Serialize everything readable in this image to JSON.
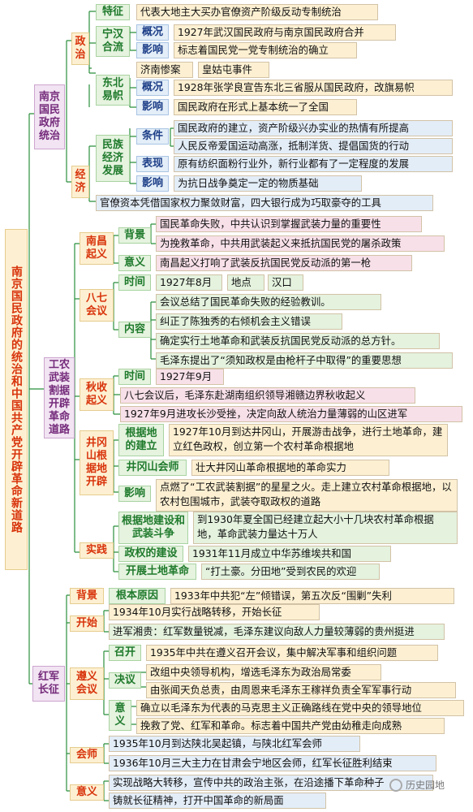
{
  "root": "南京国民政府的统治和中国共产党开辟革命新道路",
  "sections": {
    "nanjing": {
      "title": "南京国民政府统治",
      "politics": "政治",
      "economy": "经济",
      "tezheng_label": "特征",
      "tezheng": "代表大地主大买办官僚资产阶级反动专制统治",
      "ninghan_label": "宁汉合流",
      "ninghan_gaikuang_label": "概况",
      "ninghan_gaikuang": "1927年武汉国民政府与南京国民政府合并",
      "ninghan_yingxiang_label": "影响",
      "ninghan_yingxiang": "标志着国民党一党专制统治的确立",
      "jinan": "济南惨案",
      "jinan_desc": "皇姑屯事件",
      "dongbei_label": "东北易帜",
      "dongbei_gaikuang_label": "概况",
      "dongbei_gaikuang": "1928年张学良宣告东北三省服从国民政府，改旗易帜",
      "dongbei_yingxiang_label": "影响",
      "dongbei_yingxiang": "国民政府在形式上基本统一了全国",
      "minzu_label": "民族经济发展",
      "tiaojian_label": "条件",
      "tiaojian_1": "国民政府的建立，资产阶级兴办实业的热情有所提高",
      "tiaojian_2": "人民反帝爱国运动高涨，抵制洋货、提倡国货的行动",
      "biaoxian_label": "表现",
      "biaoxian": "原有纺织面粉行业外，新行业都有了一定程度的发展",
      "minzu_yingxiang_label": "影响",
      "minzu_yingxiang": "为抗日战争奠定一定的物质基础",
      "guanliao": "官僚资本凭借国家权力聚敛财富，四大银行成为巧取豪夺的工具"
    },
    "gongnong": {
      "title": "工农武装割据开辟革命道路",
      "nanchang_label": "南昌起义",
      "beijing_label": "背景",
      "beijing_1": "国民革命失败，中共认识到掌握武装力量的重要性",
      "beijing_2": "为挽救革命，中共用武装起义来抵抗国民党的屠杀政策",
      "yiyi_label": "意义",
      "yiyi": "南昌起义打响了武装反抗国民党反动派的第一枪",
      "baqi_label": "八七会议",
      "shijian_label": "时间",
      "shijian": "1927年8月",
      "didian_label": "地点",
      "didian": "汉口",
      "neirong_label": "内容",
      "neirong_1": "会议总结了国民革命失败的经验教训。",
      "neirong_2": "纠正了陈独秀的右倾机会主义错误",
      "neirong_3": "确定实行土地革命和武装反抗国民党反动派的总方针。",
      "neirong_4": "毛泽东提出了“须知政权是由枪杆子中取得”的重要思想",
      "qiushou_label": "秋收起义",
      "qiushou_shijian_label": "时间",
      "qiushou_shijian": "1927年9月",
      "qiushou_1": "八七会议后，毛泽东赴湖南组织领导湘赣边界秋收起义",
      "qiushou_2": "1927年9月进攻长沙受挫，决定向敌人统治力量薄弱的山区进军",
      "jinggang_label": "井冈山根据地开辟",
      "genjudi_label": "根据地的建立",
      "genjudi": "1927年10月到达井冈山，开展游击战争，进行土地革命，建立红色政权，创立第一个农村革命根据地",
      "huishi_label": "井冈山会师",
      "huishi": "壮大井冈山革命根据地的革命实力",
      "jg_yingxiang_label": "影响",
      "jg_yingxiang": "点燃了“工农武装割据”的星星之火。走上建立农村革命根据地，以农村包围城市，武装夺取政权的道路",
      "shijian2_label": "实践",
      "wuzhuang_label": "根据地建设和武装斗争",
      "wuzhuang": "到1930年夏全国已经建立起大小十几块农村革命根据地，革命武装力量达十万人",
      "zhengquan_label": "政权的建设",
      "zhengquan": "1931年11月成立中华苏维埃共和国",
      "tudi_label": "开展土地革命",
      "tudi": "“打土豪。分田地”受到农民的欢迎"
    },
    "changzheng": {
      "title": "红军长征",
      "beijing_label": "背景",
      "genben_label": "根本原因",
      "genben": "1933年中共犯“左”倾错误，第五次反“围剿”失利",
      "kaishi_label": "开始",
      "kaishi_1": "1934年10月实行战略转移，开始长征",
      "kaishi_2": "进军湘贵：红军数量锐减，毛泽东建议向敌人力量较薄弱的贵州挺进",
      "zunyi_label": "遵义会议",
      "zhaokai_label": "召开",
      "zhaokai": "1935年中共在遵义召开会议，集中解决军事和组织问题",
      "jueyi_label": "决议",
      "jueyi_1": "改组中央领导机构，增选毛泽东为政治局常委",
      "jueyi_2": "由张闻天负总责，由周恩来毛泽东王稼祥负责全军军事行动",
      "zunyi_yiyi_label": "意义",
      "zunyi_yiyi_1": "确立以毛泽东为代表的马克思主义正确路线在党中央的领导地位",
      "zunyi_yiyi_2": "挽救了党、红军和革命。标志着中国共产党由幼稚走向成熟",
      "huishi_label": "会师",
      "huishi_1": "1935年10月到达陕北吴起镇，与陕北红军会师",
      "huishi_2": "1936年10月三大主力在甘肃会宁地区会师，红军长征胜利结束",
      "yiyi_label": "意义",
      "yiyi_1": "实现战略大转移，宣传中共的政治主张，在沿途播下革命种子",
      "yiyi_2": "铸就长征精神，打开中国革命的新局面"
    }
  },
  "watermark": "历史园地"
}
